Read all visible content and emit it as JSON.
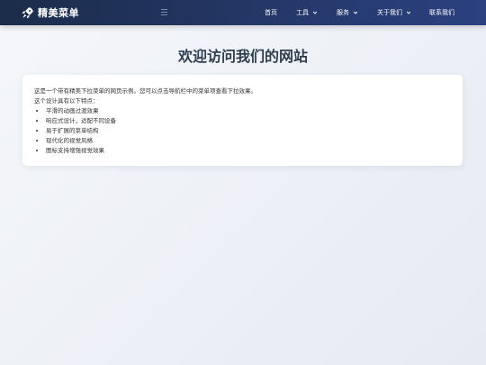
{
  "brand": {
    "logo_icon": "rocket-icon",
    "name": "精美菜单"
  },
  "nav": {
    "toggle_icon": "menu-icon",
    "items": [
      {
        "label": "首页",
        "has_dropdown": false
      },
      {
        "label": "工具",
        "has_dropdown": true
      },
      {
        "label": "服务",
        "has_dropdown": true
      },
      {
        "label": "关于我们",
        "has_dropdown": true
      },
      {
        "label": "联系我们",
        "has_dropdown": false
      }
    ]
  },
  "main": {
    "title": "欢迎访问我们的网站",
    "intro": "这是一个带有精美下拉菜单的网页示例。您可以点击导航栏中的菜单项查看下拉效果。",
    "features_heading": "这个设计具有以下特点：",
    "features": [
      "平滑的动画过渡效果",
      "响应式设计，适配不同设备",
      "易于扩展的菜单结构",
      "现代化的视觉风格",
      "图标支持增强视觉效果"
    ]
  },
  "colors": {
    "navbar_start": "#1b2c4a",
    "navbar_end": "#2b4180",
    "title": "#2c3e50",
    "background": "#eef1f6"
  }
}
